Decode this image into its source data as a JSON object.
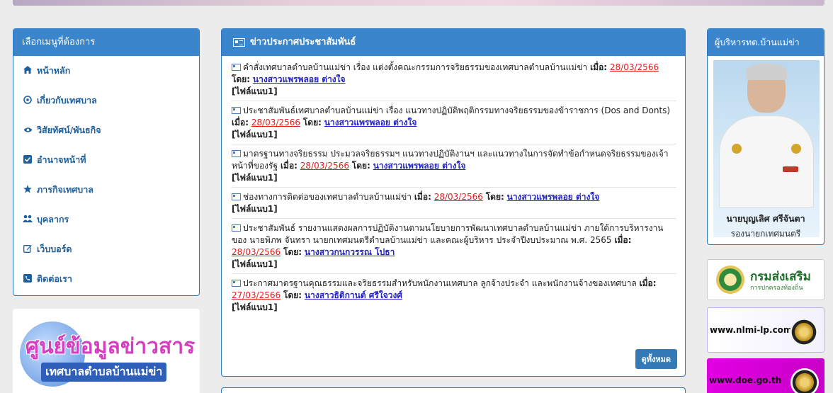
{
  "menu": {
    "title": "เลือกเมนูที่ต้องการ",
    "items": [
      {
        "label": "หน้าหลัก"
      },
      {
        "label": "เกี่ยวกับเทศบาล"
      },
      {
        "label": "วิสัยทัศน์/พันธกิจ"
      },
      {
        "label": "อำนาจหน้าที่"
      },
      {
        "label": "ภารกิจเทศบาล"
      },
      {
        "label": "บุคลากร"
      },
      {
        "label": "เว็บบอร์ด"
      },
      {
        "label": "ติดต่อเรา"
      }
    ]
  },
  "info_banner": {
    "big": "ศูนย์ข้อมูลข่าวสาร",
    "small": "เทศบาลตำบลบ้านแม่ข่า"
  },
  "news": {
    "title": "ข่าวประกาศประชาสัมพันธ์",
    "date_label": "เมื่อ:",
    "by_label": "โดย:",
    "attach_label": "[ไฟล์แนบ1]",
    "see_all": "ดูทั้งหมด",
    "items": [
      {
        "text": "คำสั่งเทศบาลตำบลบ้านแม่ข่า เรื่อง แต่งตั้งคณะกรรมการจริยธรรมของเทศบาลตำบลบ้านแม่ข่า",
        "date": "28/03/2566",
        "author": "นางสาวแพรพลอย ต่างใจ"
      },
      {
        "text": "ประชาสัมพันธ์เทศบาลตำบลบ้านแม่ข่า เรื่อง แนวทางปฏิบัติพฤติกรรมทางจริยธรรมของข้าราชการ (Dos and Donts)",
        "date": "28/03/2566",
        "author": "นางสาวแพรพลอย ต่างใจ"
      },
      {
        "text": "มาตรฐานทางจริยธรรม ประมวลจริยธรรมฯ แนวทางปฏิบัติงานฯ และแนวทางในการจัดทำข้อกำหนดจริยธรรมของเจ้าหน้าที่ของรัฐ",
        "date": "28/03/2566",
        "author": "นางสาวแพรพลอย ต่างใจ"
      },
      {
        "text": "ช่องทางการติดต่อของเทศบาลตำบลบ้านแม่ข่า",
        "date": "28/03/2566",
        "author": "นางสาวแพรพลอย ต่างใจ"
      },
      {
        "text": "ประชาสัมพันธ์ รายงานแสดงผลการปฏิบัติงานตามนโยบายการพัฒนาเทศบาลตำบลบ้านแม่ข่า ภายใต้การบริหารงานของ นายพิภพ จันทรา นายกเทศมนตรีตำบลบ้านแม่ข่า และคณะผู้บริหาร ประจำปีงบประมาณ พ.ศ. 2565",
        "date": "28/03/2566",
        "author": "นางสาวกนกวรรณ โปธา"
      },
      {
        "text": "ประกาศมาตรฐานคุณธรรมและจริยธรรมสำหรับพนักงานเทศบาล ลูกจ้างประจำ และพนักงานจ้างของเทศบาล ",
        "date": "27/03/2566",
        "author": "นางสาวธิติกานต์ ศรีใจวงศ์"
      }
    ]
  },
  "admin": {
    "title": "ผู้บริหารทต.บ้านแม่ข่า",
    "name": "นายบุญเลิศ ศรีจันตา",
    "position": "รองนายกเทศมนตรี"
  },
  "links": {
    "dla_title": "กรมส่งเสริม",
    "dla_sub": "การปกครองท้องถิ่น",
    "nlmi": "www.nlmi-lp.com",
    "doe": "www.doe.go.th"
  }
}
